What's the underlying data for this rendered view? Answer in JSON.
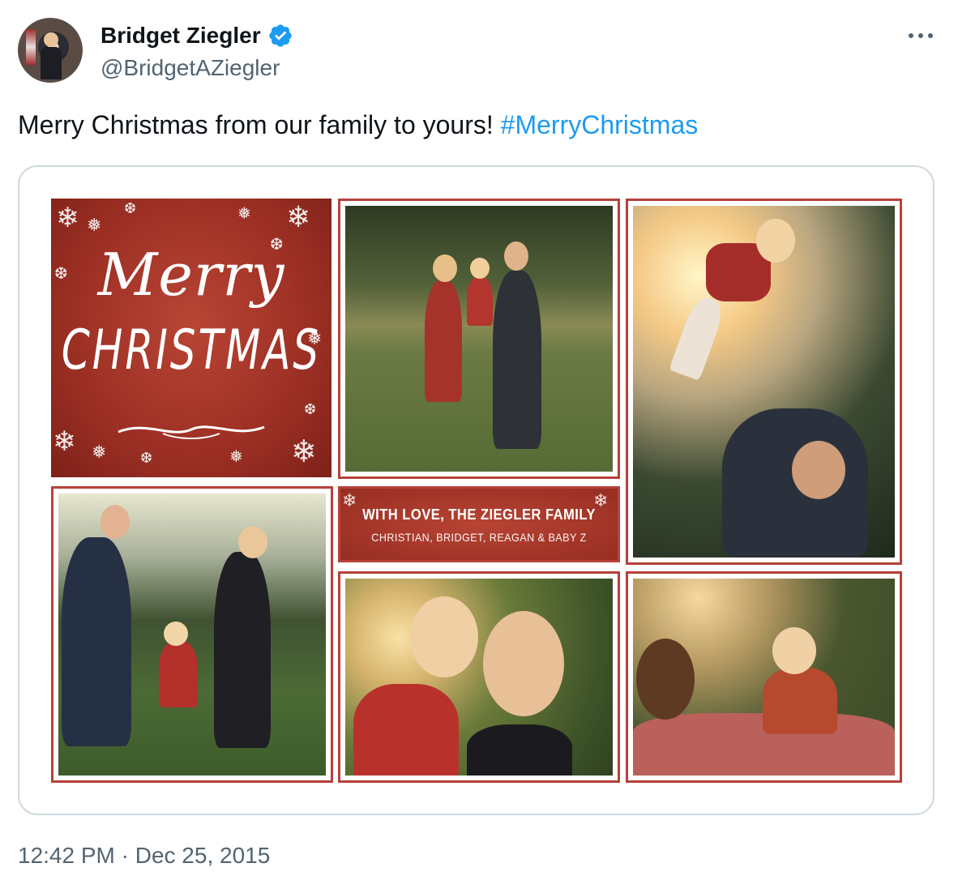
{
  "author": {
    "display_name": "Bridget Ziegler",
    "handle": "@BridgetAZiegler",
    "verified": true
  },
  "tweet": {
    "text": "Merry Christmas from our family to yours! ",
    "hashtag": "#MerryChristmas"
  },
  "card": {
    "greeting_script": "Merry",
    "greeting_caps": "CHRISTMAS",
    "banner_line1": "WITH LOVE, THE ZIEGLER FAMILY",
    "banner_line2": "CHRISTIAN, BRIDGET, REAGAN & BABY Z"
  },
  "meta": {
    "timestamp": "12:42 PM · Dec 25, 2015"
  },
  "colors": {
    "text": "#0f1419",
    "secondary": "#536471",
    "link": "#1d9bf0",
    "verified": "#1d9bf0",
    "card_red": "#b7413a",
    "border": "#cfd9de"
  },
  "icons": [
    "verified-badge-icon",
    "more-options-icon",
    "snowflake-icon"
  ]
}
